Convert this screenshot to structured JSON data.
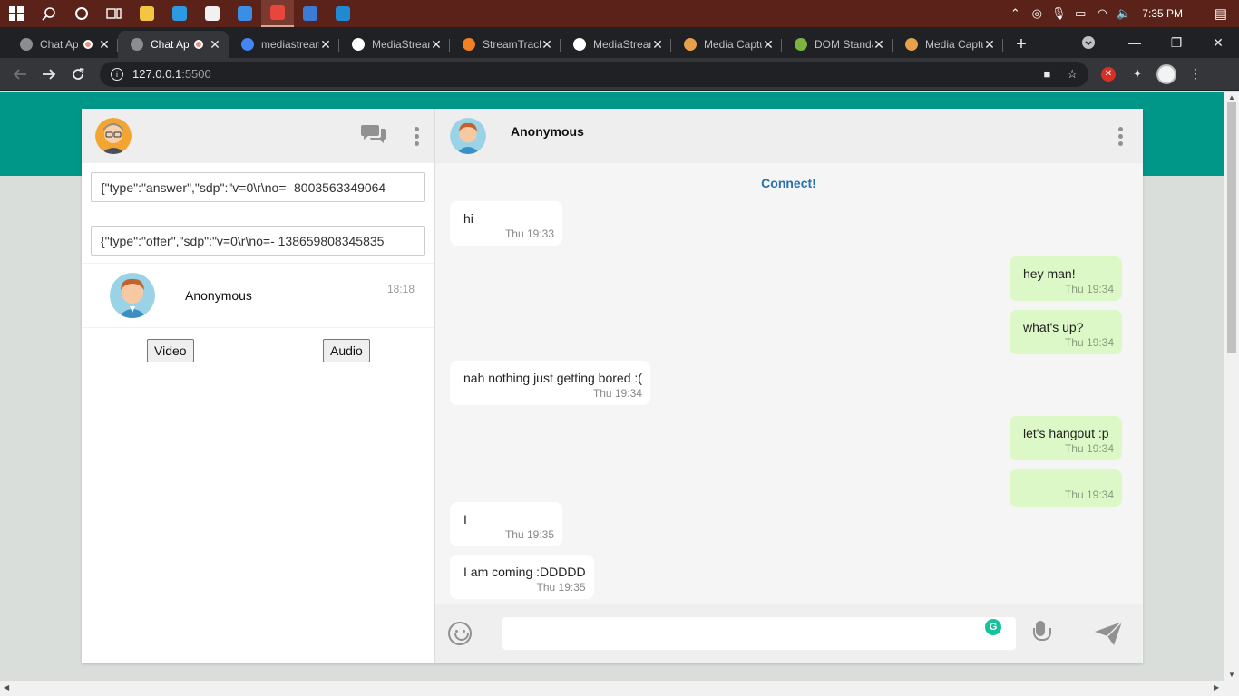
{
  "taskbar": {
    "pinned": [
      {
        "name": "file-explorer-app",
        "color": "#f4c542"
      },
      {
        "name": "edge-app",
        "color": "#2b9ae0"
      },
      {
        "name": "store-app",
        "color": "#f1f1f1"
      },
      {
        "name": "mail-app",
        "color": "#3a8ee6"
      },
      {
        "name": "chrome-app",
        "color": "#e8453c",
        "active": true
      },
      {
        "name": "notepad-app",
        "color": "#3b7bd5"
      },
      {
        "name": "vscode-app",
        "color": "#1f8ad2"
      }
    ],
    "clock": "7:35 PM"
  },
  "browser": {
    "tabs": [
      {
        "title": "Chat App",
        "favicon": "#8a8d91",
        "recording": true,
        "active": false
      },
      {
        "title": "Chat App",
        "favicon": "#8a8d91",
        "recording": true,
        "active": true
      },
      {
        "title": "mediastream",
        "favicon": "#4285f4",
        "recording": false,
        "active": false
      },
      {
        "title": "MediaStream",
        "favicon": "#ffffff",
        "recording": false,
        "active": false
      },
      {
        "title": "StreamTrack",
        "favicon": "#f48024",
        "recording": false,
        "active": false
      },
      {
        "title": "MediaStream",
        "favicon": "#ffffff",
        "recording": false,
        "active": false
      },
      {
        "title": "Media Capture",
        "favicon": "#e8a04b",
        "recording": false,
        "active": false
      },
      {
        "title": "DOM Standard",
        "favicon": "#7cb342",
        "recording": false,
        "active": false
      },
      {
        "title": "Media Capture",
        "favicon": "#e8a04b",
        "recording": false,
        "active": false
      }
    ],
    "url_host": "127.0.0.1",
    "url_port": ":5500"
  },
  "sidebar": {
    "sdp_answer": "{\"type\":\"answer\",\"sdp\":\"v=0\\r\\no=- 8003563349064",
    "sdp_offer": "{\"type\":\"offer\",\"sdp\":\"v=0\\r\\no=- 138659808345835",
    "contact": {
      "name": "Anonymous",
      "time": "18:18"
    },
    "video_label": "Video",
    "audio_label": "Audio"
  },
  "chat": {
    "header_name": "Anonymous",
    "connect_label": "Connect!",
    "messages": [
      {
        "dir": "in",
        "text": "hi",
        "time": "Thu 19:33"
      },
      {
        "dir": "out",
        "text": "hey man!",
        "time": "Thu 19:34"
      },
      {
        "dir": "out",
        "text": "what's up?",
        "time": "Thu 19:34"
      },
      {
        "dir": "in",
        "text": "nah nothing just getting bored :(",
        "time": "Thu 19:34"
      },
      {
        "dir": "out",
        "text": "let's hangout :p",
        "time": "Thu 19:34"
      },
      {
        "dir": "out",
        "text": "",
        "time": "Thu 19:34"
      },
      {
        "dir": "in",
        "text": "I",
        "time": "Thu 19:35"
      },
      {
        "dir": "in",
        "text": "I am coming :DDDDD",
        "time": "Thu 19:35"
      }
    ],
    "input_value": ""
  }
}
